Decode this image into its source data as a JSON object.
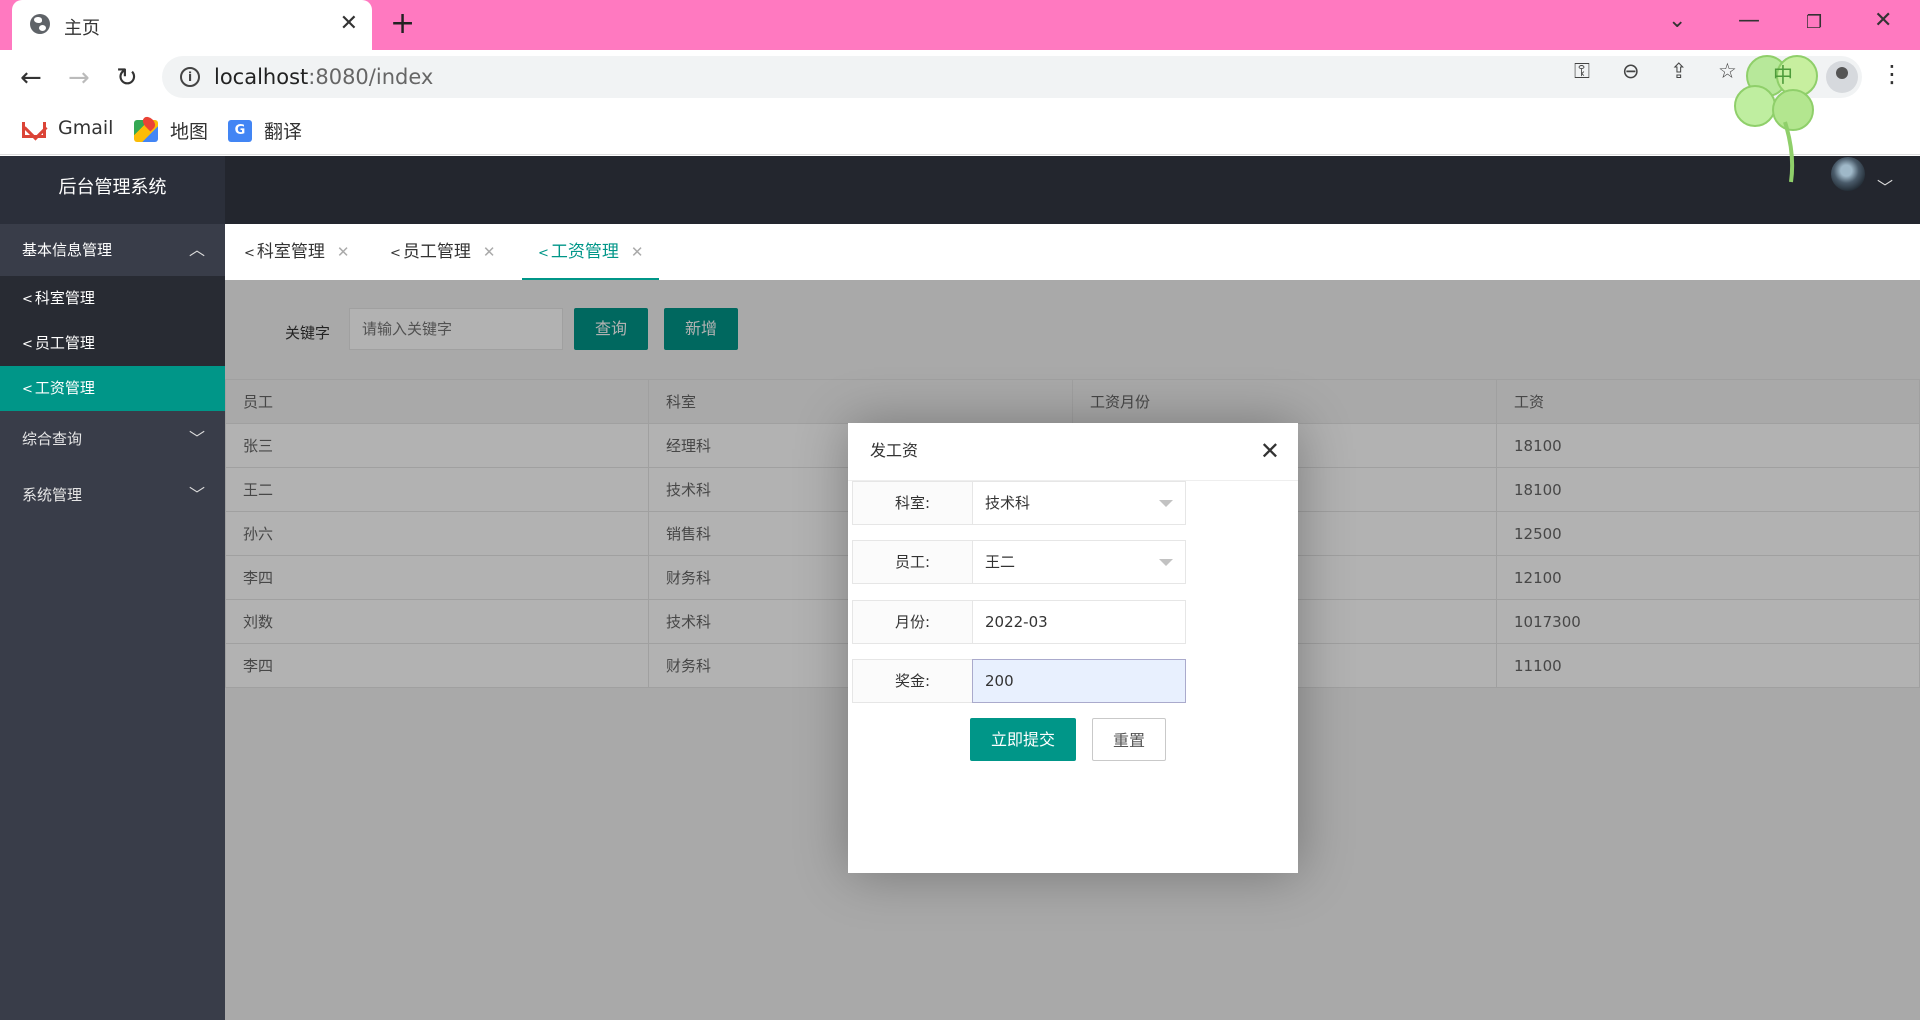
{
  "browser": {
    "tab_title": "主页",
    "url_host": "localhost",
    "url_rest": ":8080/index",
    "bookmarks": [
      {
        "label": "Gmail",
        "icon": "gmail-icon"
      },
      {
        "label": "地图",
        "icon": "maps-icon"
      },
      {
        "label": "翻译",
        "icon": "translate-icon"
      }
    ],
    "ime_badge": "中"
  },
  "app": {
    "logo": "后台管理系统",
    "sidebar": {
      "groups": [
        {
          "label": "基本信息管理",
          "expanded": true,
          "items": [
            "科室管理",
            "员工管理",
            "工资管理"
          ],
          "active_item": "工资管理"
        },
        {
          "label": "综合查询",
          "expanded": false
        },
        {
          "label": "系统管理",
          "expanded": false
        }
      ]
    },
    "tabs": [
      {
        "label": "科室管理"
      },
      {
        "label": "员工管理"
      },
      {
        "label": "工资管理",
        "active": true
      }
    ],
    "search": {
      "label": "关键字",
      "placeholder": "请输入关键字",
      "query_button": "查询",
      "add_button": "新增"
    },
    "table": {
      "columns": [
        "员工",
        "科室",
        "工资月份",
        "工资"
      ],
      "rows": [
        [
          "张三",
          "经理科",
          "",
          "18100"
        ],
        [
          "王二",
          "技术科",
          "",
          "18100"
        ],
        [
          "孙六",
          "销售科",
          "",
          "12500"
        ],
        [
          "李四",
          "财务科",
          "",
          "12100"
        ],
        [
          "刘数",
          "技术科",
          "",
          "1017300"
        ],
        [
          "李四",
          "财务科",
          "",
          "11100"
        ]
      ]
    },
    "dialog": {
      "title": "发工资",
      "fields": [
        {
          "label": "科室:",
          "value": "技术科",
          "type": "select"
        },
        {
          "label": "员工:",
          "value": "王二",
          "type": "select"
        },
        {
          "label": "月份:",
          "value": "2022-03",
          "type": "text"
        },
        {
          "label": "奖金:",
          "value": "200",
          "type": "text"
        }
      ],
      "submit_button": "立即提交",
      "reset_button": "重置"
    }
  },
  "colors": {
    "accent": "#009688",
    "sidebar": "#393d49",
    "topbar": "#23262e",
    "browser_tabstrip": "#ff79c0"
  }
}
